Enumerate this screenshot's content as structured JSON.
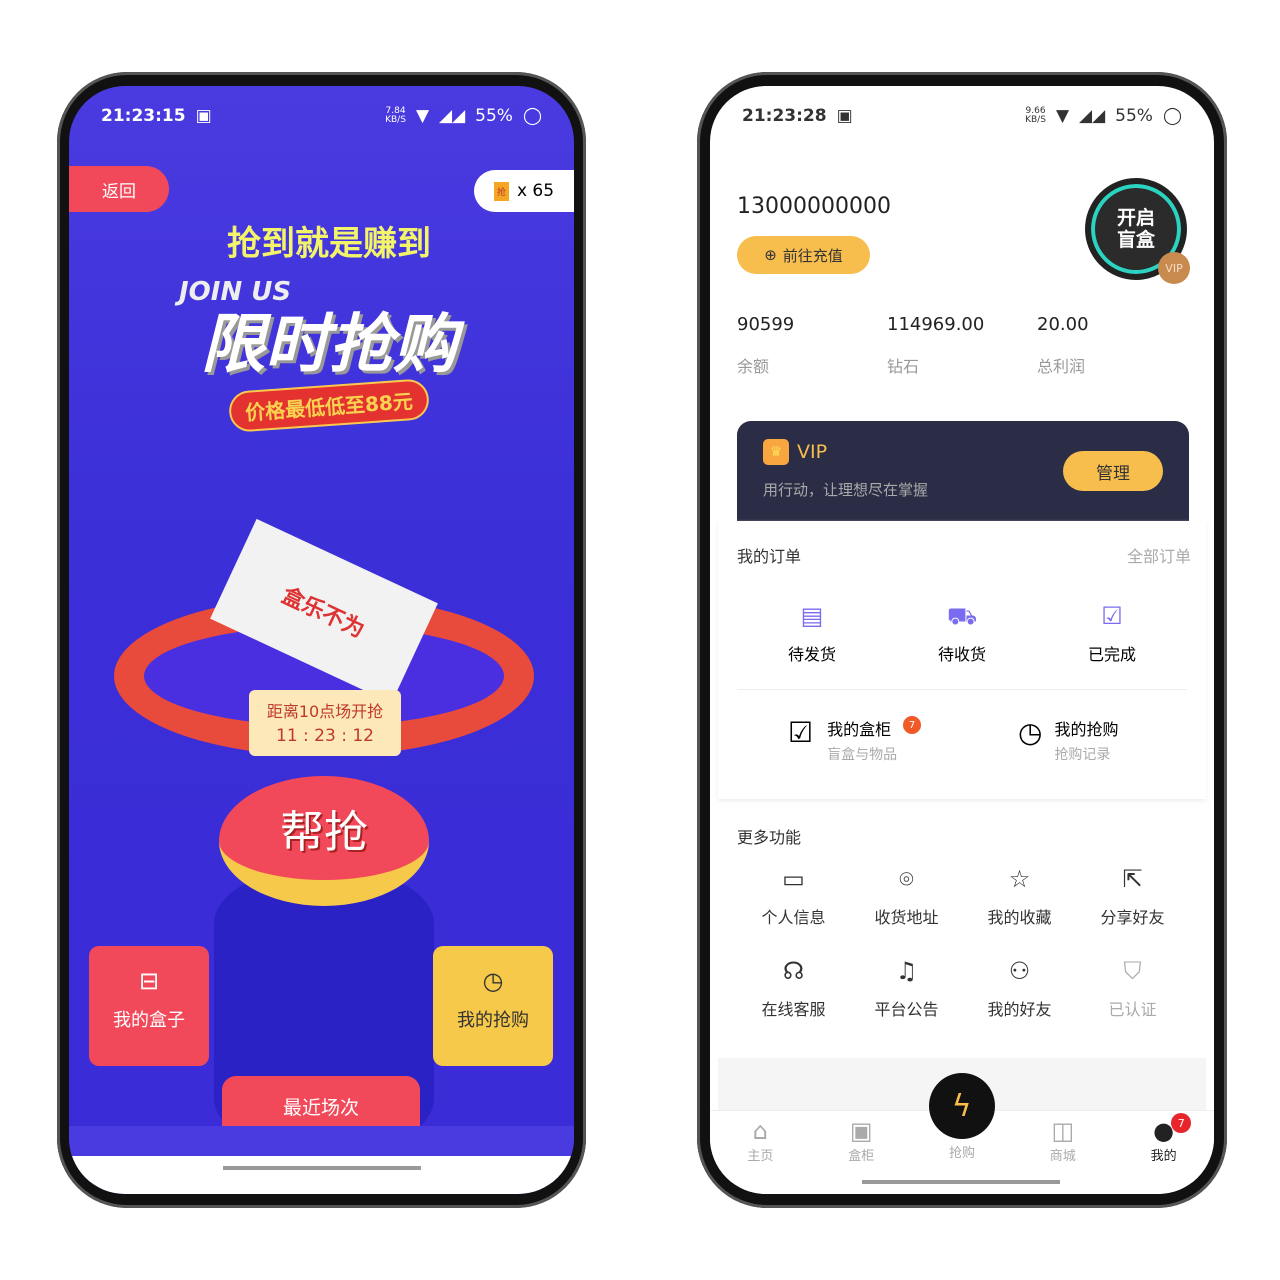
{
  "left": {
    "status": {
      "time": "21:23:15",
      "speed": "7.84",
      "speed_unit": "KB/S",
      "battery": "55%"
    },
    "back_label": "返回",
    "ticket_icon_text": "抢",
    "ticket_count": "x 65",
    "banner": {
      "slogan": "抢到就是赚到",
      "join": "JOIN US",
      "title": "限时抢购",
      "price": "价格最低低至88元"
    },
    "box_label": "盒乐不为",
    "countdown": {
      "label": "距离10点场开抢",
      "time": "11 : 23 : 12"
    },
    "grab_button": "帮抢",
    "my_box": "我的盒子",
    "my_grab": "我的抢购",
    "recent": "最近场次"
  },
  "right": {
    "status": {
      "time": "21:23:28",
      "speed": "9.66",
      "speed_unit": "KB/S",
      "battery": "55%"
    },
    "phone_number": "13000000000",
    "recharge": "前往充值",
    "avatar": {
      "line1": "开启",
      "line2": "盲盒",
      "vip": "VIP"
    },
    "stats": [
      {
        "value": "90599",
        "label": "余额"
      },
      {
        "value": "114969.00",
        "label": "钻石"
      },
      {
        "value": "20.00",
        "label": "总利润"
      }
    ],
    "vip_card": {
      "title": "VIP",
      "subtitle": "用行动，让理想尽在掌握",
      "button": "管理"
    },
    "orders": {
      "title": "我的订单",
      "all": "全部订单",
      "items": [
        {
          "label": "待发货",
          "icon": "package-icon"
        },
        {
          "label": "待收货",
          "icon": "truck-icon"
        },
        {
          "label": "已完成",
          "icon": "check-clipboard-icon"
        }
      ]
    },
    "cabinet": {
      "title": "我的盒柜",
      "sub": "盲盒与物品",
      "badge": "7"
    },
    "grab_record": {
      "title": "我的抢购",
      "sub": "抢购记录"
    },
    "more": {
      "title": "更多功能",
      "items": [
        {
          "label": "个人信息",
          "icon": "id-card-icon"
        },
        {
          "label": "收货地址",
          "icon": "location-pin-icon"
        },
        {
          "label": "我的收藏",
          "icon": "star-icon"
        },
        {
          "label": "分享好友",
          "icon": "share-icon"
        },
        {
          "label": "在线客服",
          "icon": "headset-icon"
        },
        {
          "label": "平台公告",
          "icon": "bell-icon"
        },
        {
          "label": "我的好友",
          "icon": "friends-icon"
        },
        {
          "label": "已认证",
          "icon": "shield-check-icon"
        }
      ]
    },
    "tabbar": [
      {
        "label": "主页"
      },
      {
        "label": "盒柜"
      },
      {
        "label": "抢购"
      },
      {
        "label": "商城"
      },
      {
        "label": "我的",
        "badge": "7"
      }
    ],
    "colors": {
      "accent": "#f7be4e",
      "dark_card": "#2a2d45",
      "badge": "#e8252b"
    }
  }
}
